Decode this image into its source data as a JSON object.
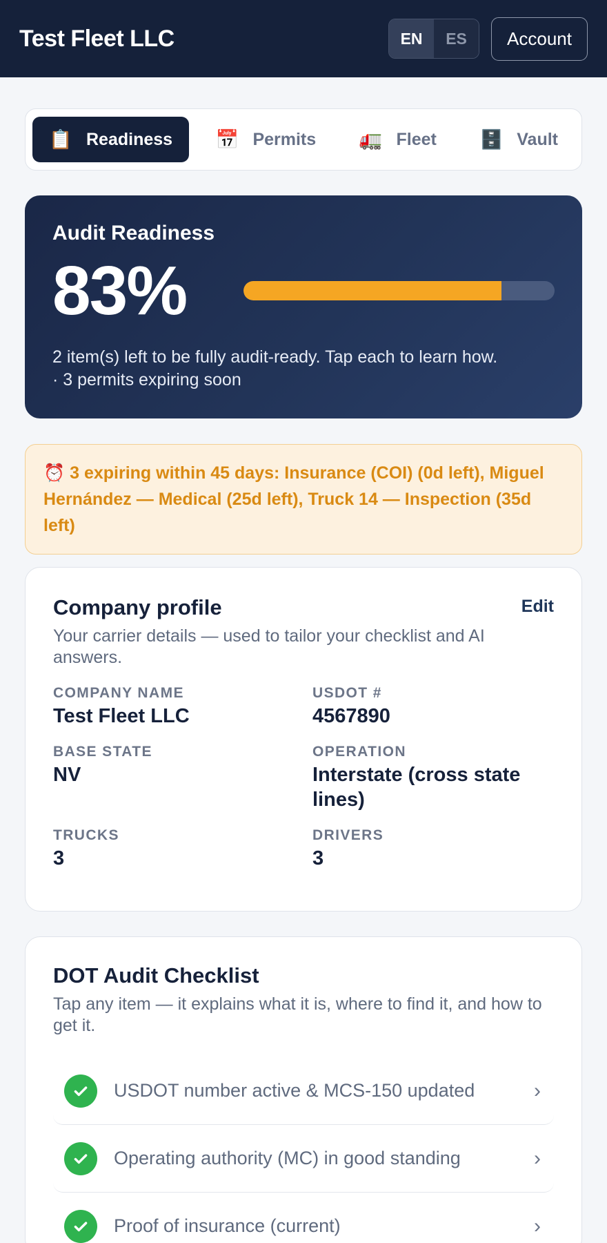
{
  "header": {
    "brand": "Test Fleet LLC",
    "lang_en": "EN",
    "lang_es": "ES",
    "account": "Account"
  },
  "tabs": [
    {
      "label": "Readiness",
      "icon": "clipboard-icon",
      "glyph": "📋",
      "active": true
    },
    {
      "label": "Permits",
      "icon": "calendar-icon",
      "glyph": "📅",
      "active": false
    },
    {
      "label": "Fleet",
      "icon": "truck-icon",
      "glyph": "🚛",
      "active": false
    },
    {
      "label": "Vault",
      "icon": "file-cabinet-icon",
      "glyph": "🗄️",
      "active": false
    }
  ],
  "readiness": {
    "title": "Audit Readiness",
    "percent_label": "83%",
    "percent_value": 83,
    "line1": "2 item(s) left to be fully audit-ready. Tap each to learn how.",
    "line2": "· 3 permits expiring soon"
  },
  "alert": {
    "icon": "alarm-clock-icon",
    "glyph": "⏰",
    "text": "3 expiring within 45 days: Insurance (COI) (0d left), Miguel Hernández — Medical (25d left), Truck 14 — Inspection (35d left)"
  },
  "profile": {
    "title": "Company profile",
    "edit": "Edit",
    "subtitle": "Your carrier details — used to tailor your checklist and AI answers.",
    "fields": {
      "company_label": "COMPANY NAME",
      "company_value": "Test Fleet LLC",
      "usdot_label": "USDOT #",
      "usdot_value": "4567890",
      "state_label": "BASE STATE",
      "state_value": "NV",
      "operation_label": "OPERATION",
      "operation_value": "Interstate (cross state lines)",
      "trucks_label": "TRUCKS",
      "trucks_value": "3",
      "drivers_label": "DRIVERS",
      "drivers_value": "3"
    }
  },
  "checklist": {
    "title": "DOT Audit Checklist",
    "subtitle": "Tap any item — it explains what it is, where to find it, and how to get it.",
    "items": [
      {
        "label": "USDOT number active & MCS-150 updated",
        "done": true
      },
      {
        "label": "Operating authority (MC) in good standing",
        "done": true
      },
      {
        "label": "Proof of insurance (current)",
        "done": true
      }
    ]
  },
  "colors": {
    "header_bg": "#15213a",
    "accent_orange": "#f5a623",
    "success_green": "#2fb34f",
    "alert_text": "#d98a13"
  }
}
